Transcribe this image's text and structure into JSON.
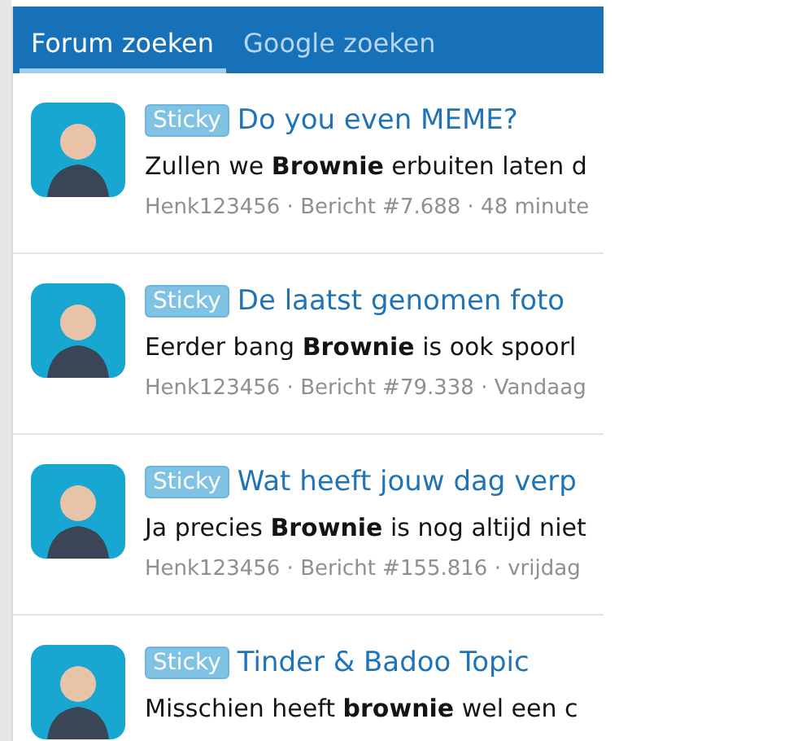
{
  "tabs": [
    {
      "label": "Forum zoeken",
      "selected": true
    },
    {
      "label": "Google zoeken",
      "selected": false
    }
  ],
  "results": [
    {
      "badge": "Sticky",
      "title": "Do you even MEME?",
      "snippet": "Zullen we **Brownie** erbuiten laten d",
      "meta": "Henk123456 · Bericht #7.688 · 48 minute"
    },
    {
      "badge": "Sticky",
      "title": "De laatst genomen foto",
      "snippet": "Eerder bang **Brownie** is ook spoorl",
      "meta": "Henk123456 · Bericht #79.338 · Vandaag"
    },
    {
      "badge": "Sticky",
      "title": "Wat heeft jouw dag verp",
      "snippet": "Ja precies **Brownie** is nog altijd niet",
      "meta": "Henk123456 · Bericht #155.816 · vrijdag"
    },
    {
      "badge": "Sticky",
      "title": "Tinder & Badoo Topic",
      "snippet": "Misschien heeft **brownie** wel een c"
    }
  ]
}
